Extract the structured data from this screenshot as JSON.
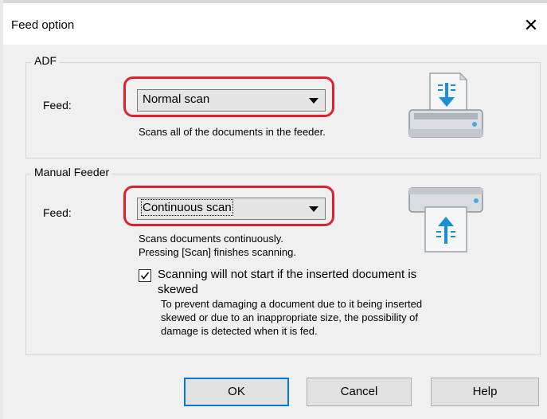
{
  "window": {
    "title": "Feed option",
    "close_glyph": "✕"
  },
  "adf": {
    "legend": "ADF",
    "feed_label": "Feed:",
    "feed_value": "Normal scan",
    "description": "Scans all of the documents in the feeder.",
    "illustration_icon": "scanner-adf-icon"
  },
  "manual": {
    "legend": "Manual Feeder",
    "feed_label": "Feed:",
    "feed_value": "Continuous scan",
    "description_line1": "Scans documents continuously.",
    "description_line2": "Pressing [Scan] finishes scanning.",
    "illustration_icon": "scanner-manual-feed-icon",
    "checkbox_checked": true,
    "checkbox_label_line1": "Scanning will not start if the inserted document is",
    "checkbox_label_line2": "skewed",
    "note_line1": "To prevent damaging a document due to it being inserted",
    "note_line2": "skewed or due to an inappropriate size, the possibility of",
    "note_line3": "damage is detected when it is fed."
  },
  "buttons": {
    "ok": "OK",
    "cancel": "Cancel",
    "help": "Help"
  },
  "colors": {
    "highlight": "#e0202e",
    "default_button_border": "#0078d7",
    "scanner_arrow": "#1a8fd6"
  }
}
